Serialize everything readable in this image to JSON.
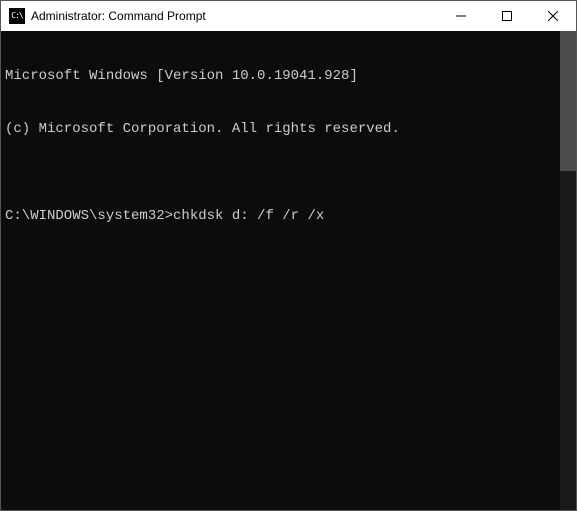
{
  "window": {
    "title": "Administrator: Command Prompt",
    "icon_text": "C:\\"
  },
  "console": {
    "line1": "Microsoft Windows [Version 10.0.19041.928]",
    "line2": "(c) Microsoft Corporation. All rights reserved.",
    "blank": "",
    "prompt": "C:\\WINDOWS\\system32>",
    "command": "chkdsk d: /f /r /x"
  }
}
